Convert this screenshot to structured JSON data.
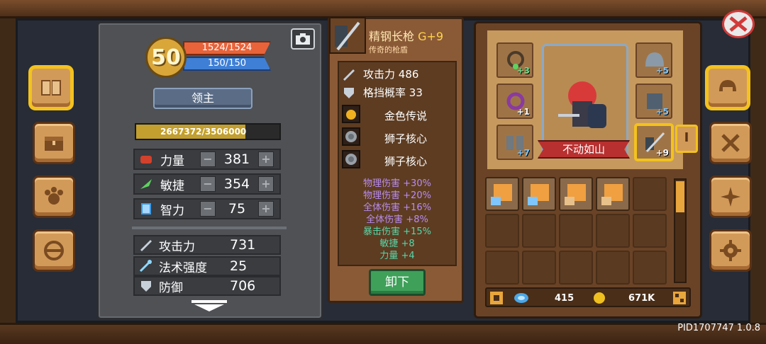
{
  "level": "50",
  "hp": "1524/1524",
  "mp": "150/150",
  "title": "领主",
  "xp": "2667372/3506000",
  "xp_progress": 0.76,
  "attributes": [
    {
      "icon": "fist-icon",
      "label": "力量",
      "value": "381"
    },
    {
      "icon": "feather-icon",
      "label": "敏捷",
      "value": "354"
    },
    {
      "icon": "book-icon",
      "label": "智力",
      "value": "75"
    }
  ],
  "derived": [
    {
      "icon": "sword-icon",
      "label": "攻击力",
      "value": "731"
    },
    {
      "icon": "wand-icon",
      "label": "法术强度",
      "value": "25"
    },
    {
      "icon": "shield-icon",
      "label": "防御",
      "value": "706"
    }
  ],
  "weapon": {
    "name": "精钢长枪",
    "plus": "G+9",
    "subtitle": "传奇的枪盾",
    "stats": [
      {
        "icon": "sword-icon",
        "label": "攻击力",
        "value": "486"
      },
      {
        "icon": "shield-icon",
        "label": "格挡概率",
        "value": "33"
      }
    ],
    "gems": [
      {
        "icon": "gold-gem-icon",
        "label": "金色传说"
      },
      {
        "icon": "lion-core-icon",
        "label": "狮子核心"
      },
      {
        "icon": "lion-core-icon",
        "label": "狮子核心"
      }
    ],
    "bonuses": [
      {
        "text": "物理伤害 +30%",
        "color": "#b98cf0"
      },
      {
        "text": "物理伤害 +20%",
        "color": "#b98cf0"
      },
      {
        "text": "全体伤害 +16%",
        "color": "#b98cf0"
      },
      {
        "text": "全体伤害 +8%",
        "color": "#b98cf0"
      },
      {
        "text": "暴击伤害 +15%",
        "color": "#57d6a8"
      },
      {
        "text": "敏捷 +8",
        "color": "#57d6a8"
      },
      {
        "text": "力量 +4",
        "color": "#57d6a8"
      }
    ],
    "unequip_label": "卸下"
  },
  "character_title": "不动如山",
  "equip_levels": {
    "amulet": "+3",
    "ring": "+1",
    "boots": "+7",
    "helmet": "+5",
    "armor": "+5",
    "weapon": "+9"
  },
  "tab_marker": "I",
  "currency": {
    "gems": "415",
    "gold": "671K"
  },
  "pid": "PID1707747 1.0.8",
  "colors": {
    "accent": "#f3c21e",
    "hp": "#e8633a",
    "mp": "#3f7fd6",
    "unequip": "#3fa05a"
  }
}
